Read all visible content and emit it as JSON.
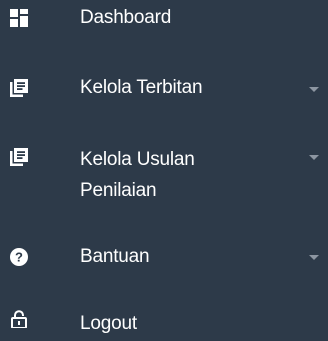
{
  "sidebar": {
    "items": [
      {
        "label": "Dashboard",
        "icon": "dashboard-icon"
      },
      {
        "label": "Kelola Terbitan",
        "icon": "list-document-icon",
        "has_dropdown": true
      },
      {
        "label": "Kelola Usulan\nPenilaian",
        "icon": "list-document-icon",
        "has_dropdown": true
      },
      {
        "label": "Bantuan",
        "icon": "help-circle-icon",
        "has_dropdown": true
      },
      {
        "label": "Logout",
        "icon": "lock-icon"
      }
    ]
  },
  "colors": {
    "background": "#2d3a49",
    "text": "#ffffff",
    "caret": "#8d96a2"
  }
}
